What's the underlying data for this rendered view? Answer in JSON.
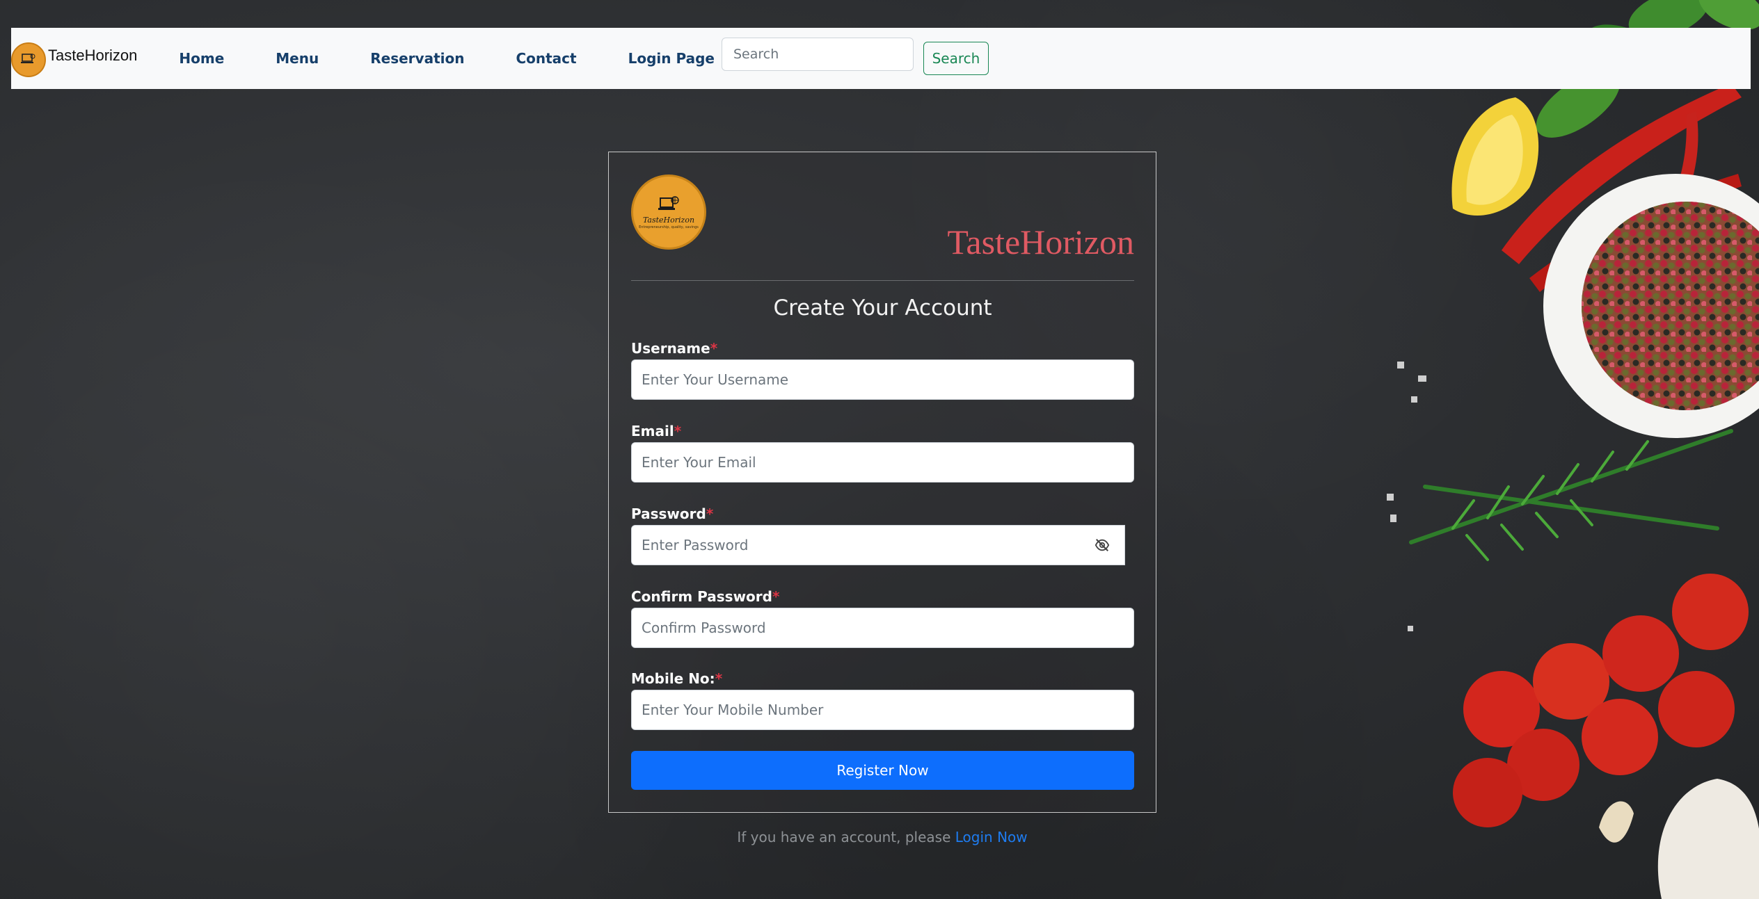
{
  "navbar": {
    "brand": "TasteHorizon",
    "links": [
      {
        "label": "Home"
      },
      {
        "label": "Menu"
      },
      {
        "label": "Reservation"
      },
      {
        "label": "Contact"
      },
      {
        "label": "Login Page"
      }
    ],
    "search": {
      "placeholder": "Search",
      "value": ""
    },
    "search_button": "Search"
  },
  "card": {
    "logo_name": "TasteHorizon",
    "logo_tagline": "Entrepreneurship, quality, savings",
    "brand_title": "TasteHorizon",
    "title": "Create Your Account",
    "fields": [
      {
        "label": "Username",
        "required_mark": "*",
        "placeholder": "Enter Your Username",
        "value": ""
      },
      {
        "label": "Email",
        "required_mark": "*",
        "placeholder": "Enter Your Email",
        "value": ""
      },
      {
        "label": "Password",
        "required_mark": "*",
        "placeholder": "Enter Password",
        "value": "",
        "icon": "eye-slash-icon"
      },
      {
        "label": "Confirm Password",
        "required_mark": "*",
        "placeholder": "Confirm Password",
        "value": ""
      },
      {
        "label": "Mobile No:",
        "required_mark": "*",
        "placeholder": "Enter Your Mobile Number",
        "value": ""
      }
    ],
    "submit": "Register Now"
  },
  "footer": {
    "text": "If you have an account, please ",
    "link": "Login Now"
  },
  "colors": {
    "background": "#2e3033",
    "brand_red": "#e05a63",
    "primary": "#0d6efd",
    "nav_link": "#163f6a",
    "search_green": "#198754",
    "logo_orange": "#e9a02d"
  }
}
